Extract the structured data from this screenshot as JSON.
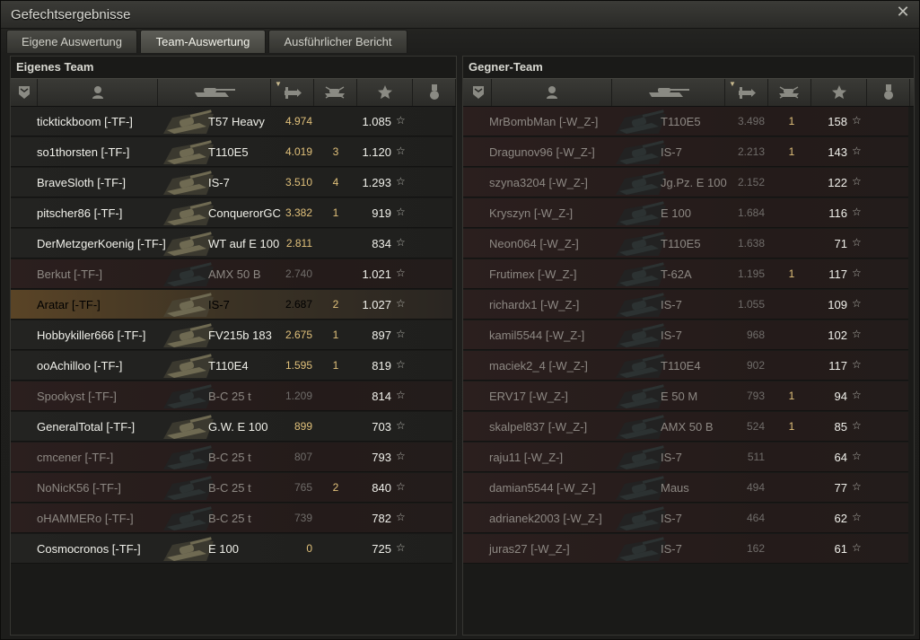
{
  "window": {
    "title": "Gefechtsergebnisse",
    "close_icon": "close-icon"
  },
  "tabs": [
    {
      "label": "Eigene Auswertung",
      "active": false
    },
    {
      "label": "Team-Auswertung",
      "active": true
    },
    {
      "label": "Ausführlicher Bericht",
      "active": false
    }
  ],
  "own_team": {
    "title": "Eigenes Team",
    "columns": [
      "rank-icon",
      "player-icon",
      "tank-icon",
      "damage-icon",
      "kills-icon",
      "xp-star-icon",
      "medal-icon"
    ],
    "rows": [
      {
        "name": "ticktickboom [-TF-]",
        "tank": "T57 Heavy",
        "damage": "4.974",
        "kills": "",
        "xp": "1.085",
        "state": "alive"
      },
      {
        "name": "so1thorsten [-TF-]",
        "tank": "T110E5",
        "damage": "4.019",
        "kills": "3",
        "xp": "1.120",
        "state": "alive"
      },
      {
        "name": "BraveSloth [-TF-]",
        "tank": "IS-7",
        "damage": "3.510",
        "kills": "4",
        "xp": "1.293",
        "state": "alive"
      },
      {
        "name": "pitscher86 [-TF-]",
        "tank": "ConquerorGC",
        "damage": "3.382",
        "kills": "1",
        "xp": "919",
        "state": "alive"
      },
      {
        "name": "DerMetzgerKoenig [-TF-]",
        "tank": "WT auf E 100",
        "damage": "2.811",
        "kills": "",
        "xp": "834",
        "state": "alive"
      },
      {
        "name": "Berkut [-TF-]",
        "tank": "AMX 50 B",
        "damage": "2.740",
        "kills": "",
        "xp": "1.021",
        "state": "dead"
      },
      {
        "name": "Aratar [-TF-]",
        "tank": "IS-7",
        "damage": "2.687",
        "kills": "2",
        "xp": "1.027",
        "state": "self"
      },
      {
        "name": "Hobbykiller666 [-TF-]",
        "tank": "FV215b 183",
        "damage": "2.675",
        "kills": "1",
        "xp": "897",
        "state": "alive"
      },
      {
        "name": "ooAchilloo [-TF-]",
        "tank": "T110E4",
        "damage": "1.595",
        "kills": "1",
        "xp": "819",
        "state": "alive"
      },
      {
        "name": "Spookyst [-TF-]",
        "tank": "B-C 25 t",
        "damage": "1.209",
        "kills": "",
        "xp": "814",
        "state": "dead"
      },
      {
        "name": "GeneralTotal [-TF-]",
        "tank": "G.W. E 100",
        "damage": "899",
        "kills": "",
        "xp": "703",
        "state": "alive"
      },
      {
        "name": "cmcener [-TF-]",
        "tank": "B-C 25 t",
        "damage": "807",
        "kills": "",
        "xp": "793",
        "state": "dead"
      },
      {
        "name": "NoNicK56 [-TF-]",
        "tank": "B-C 25 t",
        "damage": "765",
        "kills": "2",
        "xp": "840",
        "state": "dead"
      },
      {
        "name": "oHAMMERo [-TF-]",
        "tank": "B-C 25 t",
        "damage": "739",
        "kills": "",
        "xp": "782",
        "state": "dead"
      },
      {
        "name": "Cosmocronos [-TF-]",
        "tank": "E 100",
        "damage": "0",
        "kills": "",
        "xp": "725",
        "state": "alive"
      }
    ]
  },
  "enemy_team": {
    "title": "Gegner-Team",
    "columns": [
      "rank-icon",
      "player-icon",
      "tank-icon",
      "damage-icon",
      "kills-icon",
      "xp-star-icon",
      "medal-icon"
    ],
    "rows": [
      {
        "name": "MrBombMan [-W_Z-]",
        "tank": "T110E5",
        "damage": "3.498",
        "kills": "1",
        "xp": "158",
        "state": "dead"
      },
      {
        "name": "Dragunov96 [-W_Z-]",
        "tank": "IS-7",
        "damage": "2.213",
        "kills": "1",
        "xp": "143",
        "state": "dead"
      },
      {
        "name": "szyna3204 [-W_Z-]",
        "tank": "Jg.Pz. E 100",
        "damage": "2.152",
        "kills": "",
        "xp": "122",
        "state": "dead"
      },
      {
        "name": "Kryszyn [-W_Z-]",
        "tank": "E 100",
        "damage": "1.684",
        "kills": "",
        "xp": "116",
        "state": "dead"
      },
      {
        "name": "Neon064 [-W_Z-]",
        "tank": "T110E5",
        "damage": "1.638",
        "kills": "",
        "xp": "71",
        "state": "dead"
      },
      {
        "name": "Frutimex [-W_Z-]",
        "tank": "T-62A",
        "damage": "1.195",
        "kills": "1",
        "xp": "117",
        "state": "dead"
      },
      {
        "name": "richardx1 [-W_Z-]",
        "tank": "IS-7",
        "damage": "1.055",
        "kills": "",
        "xp": "109",
        "state": "dead"
      },
      {
        "name": "kamil5544 [-W_Z-]",
        "tank": "IS-7",
        "damage": "968",
        "kills": "",
        "xp": "102",
        "state": "dead"
      },
      {
        "name": "maciek2_4 [-W_Z-]",
        "tank": "T110E4",
        "damage": "902",
        "kills": "",
        "xp": "117",
        "state": "dead"
      },
      {
        "name": "ERV17 [-W_Z-]",
        "tank": "E 50 M",
        "damage": "793",
        "kills": "1",
        "xp": "94",
        "state": "dead"
      },
      {
        "name": "skalpel837 [-W_Z-]",
        "tank": "AMX 50 B",
        "damage": "524",
        "kills": "1",
        "xp": "85",
        "state": "dead"
      },
      {
        "name": "raju11 [-W_Z-]",
        "tank": "IS-7",
        "damage": "511",
        "kills": "",
        "xp": "64",
        "state": "dead"
      },
      {
        "name": "damian5544 [-W_Z-]",
        "tank": "Maus",
        "damage": "494",
        "kills": "",
        "xp": "77",
        "state": "dead"
      },
      {
        "name": "adrianek2003 [-W_Z-]",
        "tank": "IS-7",
        "damage": "464",
        "kills": "",
        "xp": "62",
        "state": "dead"
      },
      {
        "name": "juras27 [-W_Z-]",
        "tank": "IS-7",
        "damage": "162",
        "kills": "",
        "xp": "61",
        "state": "dead"
      }
    ]
  },
  "colors": {
    "accent": "#e0c07a",
    "dead_row": "#2b1f1e",
    "self_row": "#5a4426"
  }
}
